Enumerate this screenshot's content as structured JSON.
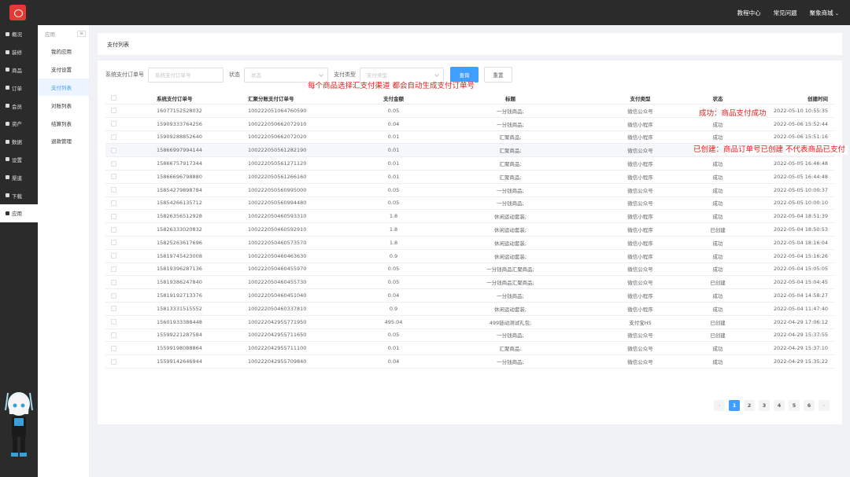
{
  "top_links": [
    "教程中心",
    "常见问题",
    "聚象商城"
  ],
  "sidebar": [
    "概况",
    "装修",
    "商品",
    "订单",
    "会员",
    "资产",
    "数据",
    "设置",
    "渠道",
    "下载",
    "应用"
  ],
  "subnav": {
    "head": "应用",
    "items": [
      "我的应用",
      "支付设置",
      "支付列表",
      "对账列表",
      "结算列表",
      "退款管理"
    ]
  },
  "breadcrumb": "支付列表",
  "filters": {
    "order_label": "系统支付订单号",
    "order_placeholder": "系统支付订单号",
    "status_label": "状态",
    "status_placeholder": "状态",
    "type_label": "支付类型",
    "type_placeholder": "支付类型",
    "search": "查询",
    "reset": "重置"
  },
  "columns": [
    "系统支付订单号",
    "汇聚分账支付订单号",
    "支付金额",
    "标题",
    "支付类型",
    "状态",
    "创建时间"
  ],
  "rows": [
    [
      "16077152528032",
      "100222051064760590",
      "0.05",
      "一分钱商品;",
      "微信公众号",
      "成功",
      "2022-05-10 10:55:35"
    ],
    [
      "15909333764256",
      "100222050662072910",
      "0.04",
      "一分钱商品;",
      "微信小程序",
      "成功",
      "2022-05-06 15:52:44"
    ],
    [
      "15909288852640",
      "100222050662072020",
      "0.01",
      "汇聚商品;",
      "微信小程序",
      "成功",
      "2022-05-06 15:51:16"
    ],
    [
      "15866997994144",
      "100222050561282190",
      "0.01",
      "汇聚商品;",
      "微信公众号",
      "已创建",
      "2022-05-05 16:50:35"
    ],
    [
      "15866757917344",
      "100222050561271120",
      "0.01",
      "汇聚商品;",
      "微信小程序",
      "成功",
      "2022-05-05 16:46:48"
    ],
    [
      "15866696798880",
      "100222050561266160",
      "0.01",
      "汇聚商品;",
      "微信小程序",
      "成功",
      "2022-05-05 16:44:48"
    ],
    [
      "15854279898784",
      "100222050560995000",
      "0.05",
      "一分钱商品;",
      "微信公众号",
      "成功",
      "2022-05-05 10:00:37"
    ],
    [
      "15854266135712",
      "100222050560994480",
      "0.05",
      "一分钱商品;",
      "微信公众号",
      "成功",
      "2022-05-05 10:00:10"
    ],
    [
      "15826356512928",
      "100222050460593310",
      "1.8",
      "休闲运动套装;",
      "微信小程序",
      "成功",
      "2022-05-04 18:51:39"
    ],
    [
      "15826333020832",
      "100222050460592910",
      "1.8",
      "休闲运动套装;",
      "微信小程序",
      "已创建",
      "2022-05-04 18:50:53"
    ],
    [
      "15825263617696",
      "100222050460573570",
      "1.8",
      "休闲运动套装;",
      "微信小程序",
      "成功",
      "2022-05-04 18:16:04"
    ],
    [
      "15819745423008",
      "100222050460463630",
      "0.9",
      "休闲运动套装;",
      "微信小程序",
      "成功",
      "2022-05-04 15:16:26"
    ],
    [
      "15819396287136",
      "100222050460455970",
      "0.05",
      "一分钱商品汇聚商品;",
      "微信公众号",
      "成功",
      "2022-05-04 15:05:05"
    ],
    [
      "15819386247840",
      "100222050460455730",
      "0.05",
      "一分钱商品汇聚商品;",
      "微信公众号",
      "已创建",
      "2022-05-04 15:04:45"
    ],
    [
      "15819192713376",
      "100222050460451040",
      "0.04",
      "一分钱商品;",
      "微信小程序",
      "成功",
      "2022-05-04 14:58:27"
    ],
    [
      "15813331515552",
      "100222050460337810",
      "0.9",
      "休闲运动套装;",
      "微信小程序",
      "成功",
      "2022-05-04 11:47:40"
    ],
    [
      "15601933388448",
      "100222042955771950",
      "495.04",
      "499链动测试礼包;",
      "支付宝H5",
      "已创建",
      "2022-04-29 17:06:12"
    ],
    [
      "15599221287584",
      "100222042955711650",
      "0.05",
      "一分钱商品;",
      "微信公众号",
      "已创建",
      "2022-04-29 15:37:55"
    ],
    [
      "15599198088864",
      "100222042955711100",
      "0.01",
      "汇聚商品;",
      "微信公众号",
      "成功",
      "2022-04-29 15:37:10"
    ],
    [
      "15599142646944",
      "100222042955709840",
      "0.04",
      "一分钱商品;",
      "微信公众号",
      "成功",
      "2022-04-29 15:35:22"
    ]
  ],
  "pagination": [
    "1",
    "2",
    "3",
    "4",
    "5",
    "6"
  ],
  "annotations": {
    "top": "每个商品选择汇支付渠道 都会自动生成支付订单号",
    "success": "成功：商品支付成功",
    "created": "已创建：商品订单号已创建 不代表商品已支付"
  }
}
